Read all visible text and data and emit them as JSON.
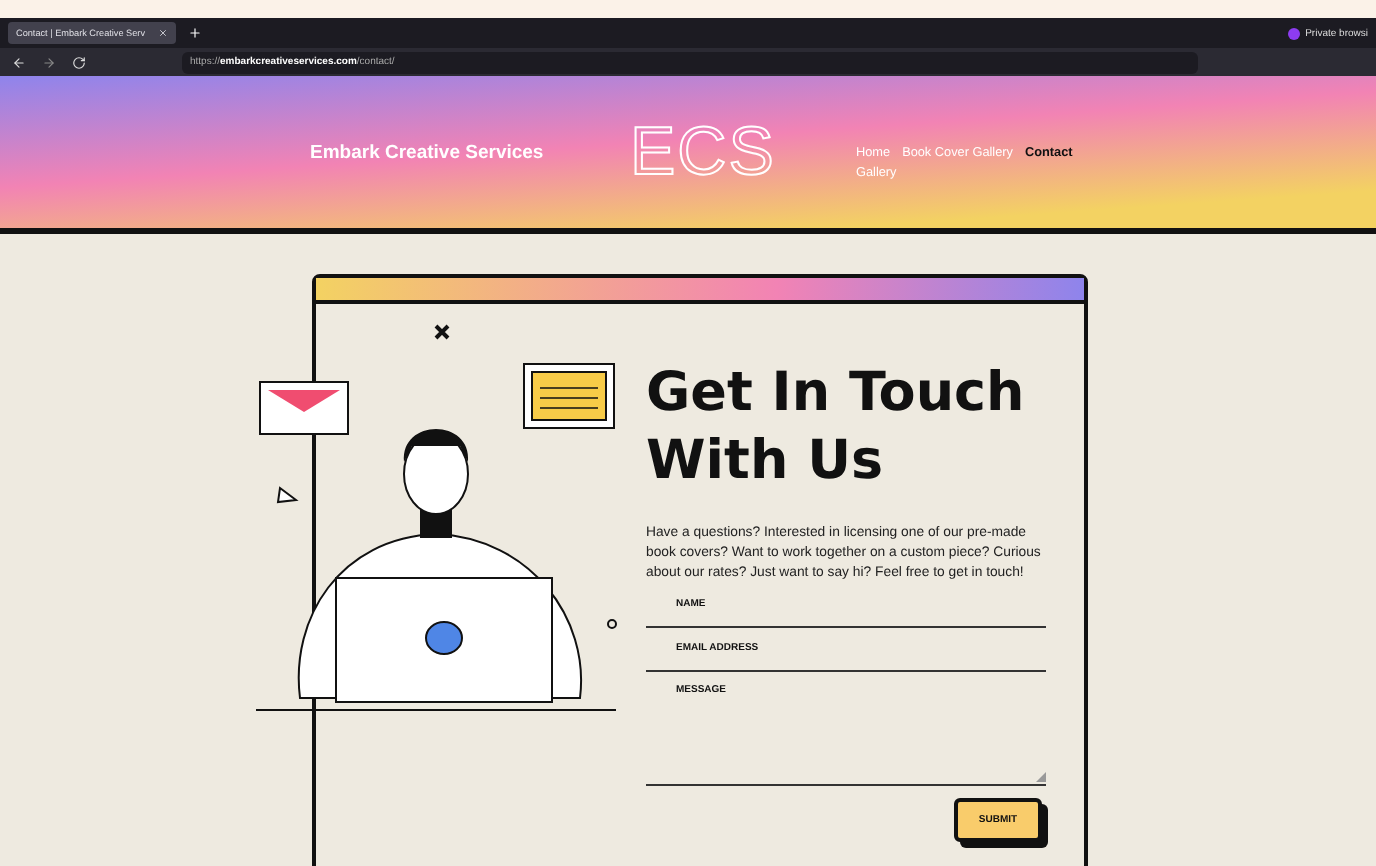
{
  "browser": {
    "tab_title": "Contact | Embark Creative Serv",
    "url": "https://**embarkcreativeservices.com**/contact/",
    "private_label": "Private browsi"
  },
  "site": {
    "title": "Embark Creative Services",
    "logo": "ECS",
    "nav": [
      {
        "label": "Home",
        "selected": false
      },
      {
        "label": "Book Cover Gallery",
        "selected": false
      },
      {
        "label": "Contact",
        "selected": true
      },
      {
        "label": "Gallery",
        "selected": false
      }
    ]
  },
  "contact": {
    "heading": "Get In Touch With Us",
    "intro": "Have a questions? Interested in licensing one of our pre-made book covers? Want to work together on a custom piece? Curious about our rates? Just want to say hi? Feel free to get in touch!",
    "fields": [
      {
        "label": "NAME",
        "kind": "line"
      },
      {
        "label": "EMAIL ADDRESS",
        "kind": "line"
      },
      {
        "label": "MESSAGE",
        "kind": "area"
      }
    ],
    "submit": "SUBMIT"
  }
}
